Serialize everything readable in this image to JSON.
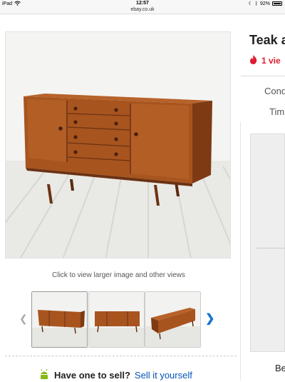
{
  "status_bar": {
    "device": "iPad",
    "time": "12:57",
    "url": "ebay.co.uk",
    "battery": "92%"
  },
  "gallery": {
    "hint": "Click to view larger image and other views",
    "prev_icon": "chevron-left-icon",
    "next_icon": "chevron-right-icon",
    "thumbnail_count": 3
  },
  "listing": {
    "title": "Teak a",
    "views": "1 vie",
    "condition_label": "Cond",
    "time_label": "Tim",
    "bottom_label": "Be"
  },
  "sell": {
    "question": "Have one to sell?",
    "link": "Sell it yourself"
  },
  "colors": {
    "link_blue": "#0654ba",
    "views_red": "#dd1e31",
    "teak": "#9a4a1c"
  }
}
